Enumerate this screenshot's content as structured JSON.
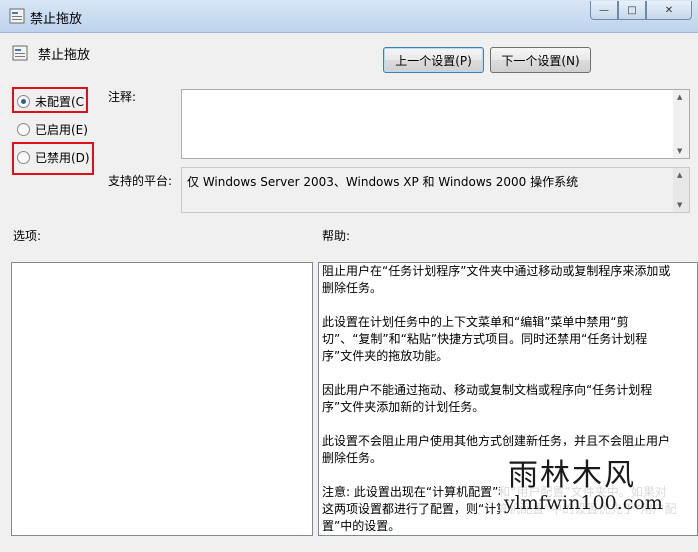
{
  "window": {
    "title": "禁止拖放",
    "minimize_glyph": "—",
    "maximize_glyph": "□",
    "close_glyph": "✕"
  },
  "header": {
    "policy_title": "禁止拖放"
  },
  "buttons": {
    "previous": "上一个设置(P)",
    "next": "下一个设置(N)"
  },
  "radios": [
    {
      "label": "未配置(C",
      "checked": true
    },
    {
      "label": "已启用(E)",
      "checked": false
    },
    {
      "label": "已禁用(D)",
      "checked": false
    }
  ],
  "labels": {
    "comment": "注释:",
    "supported_on": "支持的平台:",
    "options": "选项:",
    "help": "帮助:"
  },
  "supported_value": "仅 Windows Server 2003、Windows XP 和 Windows 2000 操作系统",
  "help_paragraphs": [
    "阻止用户在“任务计划程序”文件夹中通过移动或复制程序来添加或删除任务。",
    "此设置在计划任务中的上下文菜单和“编辑”菜单中禁用“剪切”、“复制”和“粘贴”快捷方式项目。同时还禁用“任务计划程序”文件夹的拖放功能。",
    "因此用户不能通过拖动、移动或复制文档或程序向“任务计划程序”文件夹添加新的计划任务。",
    "此设置不会阻止用户使用其他方式创建新任务，并且不会阻止用户删除任务。",
    "注意: 此设置出现在“计算机配置”和“用户配置”文件夹中。如果对这两项设置都进行了配置，则“计算机配置”中的设置优先于“用户配置”中的设置。"
  ],
  "watermark": {
    "cn": "雨林木风",
    "en": "ylmfwin100.com"
  },
  "colors": {
    "highlight_box": "#e0101a"
  }
}
